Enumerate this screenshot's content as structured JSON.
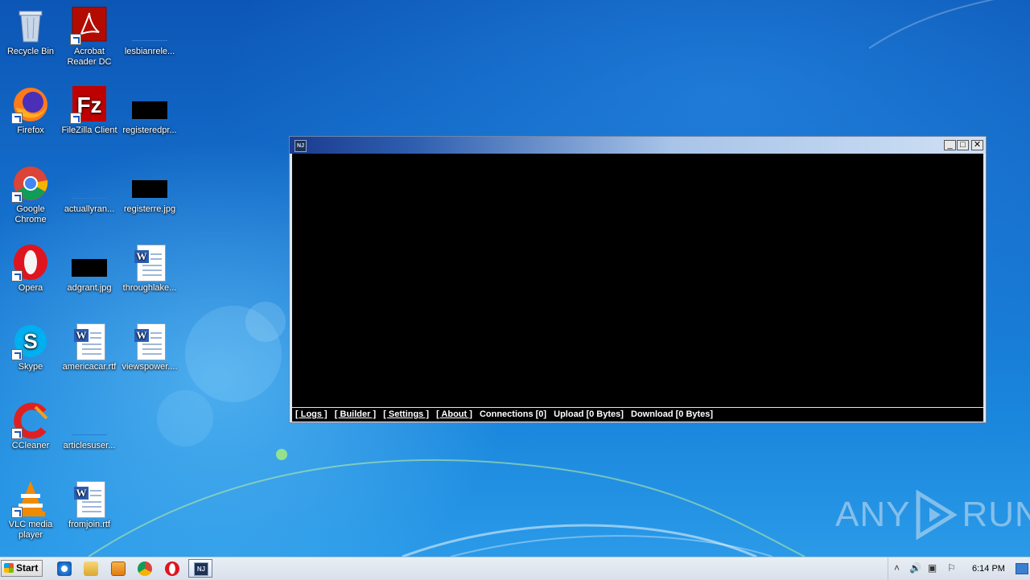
{
  "desktop": {
    "icons": [
      {
        "label": "Recycle Bin",
        "icon": "recycle-bin-icon"
      },
      {
        "label": "Acrobat Reader DC",
        "icon": "acrobat-reader-icon"
      },
      {
        "label": "lesbianrele...",
        "icon": "blank-file-icon"
      },
      {
        "label": "Firefox",
        "icon": "firefox-icon"
      },
      {
        "label": "FileZilla Client",
        "icon": "filezilla-icon"
      },
      {
        "label": "registeredpr...",
        "icon": "black-image-thumbnail"
      },
      {
        "label": "Google Chrome",
        "icon": "chrome-icon"
      },
      {
        "label": "actuallyran...",
        "icon": "blank-file-icon"
      },
      {
        "label": "registerre.jpg",
        "icon": "black-image-thumbnail"
      },
      {
        "label": "Opera",
        "icon": "opera-icon"
      },
      {
        "label": "adgrant.jpg",
        "icon": "black-image-thumbnail"
      },
      {
        "label": "throughlake...",
        "icon": "word-document-icon"
      },
      {
        "label": "Skype",
        "icon": "skype-icon"
      },
      {
        "label": "americacar.rtf",
        "icon": "word-document-icon"
      },
      {
        "label": "viewspower....",
        "icon": "word-document-icon"
      },
      {
        "label": "CCleaner",
        "icon": "ccleaner-icon"
      },
      {
        "label": "articlesuser...",
        "icon": "blank-file-icon"
      },
      {
        "label": "VLC media player",
        "icon": "vlc-icon"
      },
      {
        "label": "fromjoin.rtf",
        "icon": "word-document-icon"
      }
    ]
  },
  "window": {
    "icon_text": "NJ",
    "controls": {
      "minimize": "_",
      "maximize": "□",
      "close": "✕"
    },
    "statusbar": {
      "logs": "[ Logs ]",
      "builder": "[ Builder ]",
      "settings": "[ Settings ]",
      "about": "[ About ]",
      "connections": "Connections [0]",
      "upload": "Upload [0 Bytes]",
      "download": "Download [0 Bytes]"
    }
  },
  "watermark": {
    "left": "ANY",
    "right": "RUN"
  },
  "taskbar": {
    "start_label": "Start",
    "pinned": [
      "internet-explorer-icon",
      "file-explorer-icon",
      "media-player-icon",
      "chrome-icon",
      "opera-icon"
    ],
    "active_app_icon_text": "NJ",
    "clock": "6:14 PM"
  },
  "colors": {
    "console_bg": "#000000",
    "titlebar_start": "#1b3b8f",
    "titlebar_end": "#cfe0f5"
  }
}
